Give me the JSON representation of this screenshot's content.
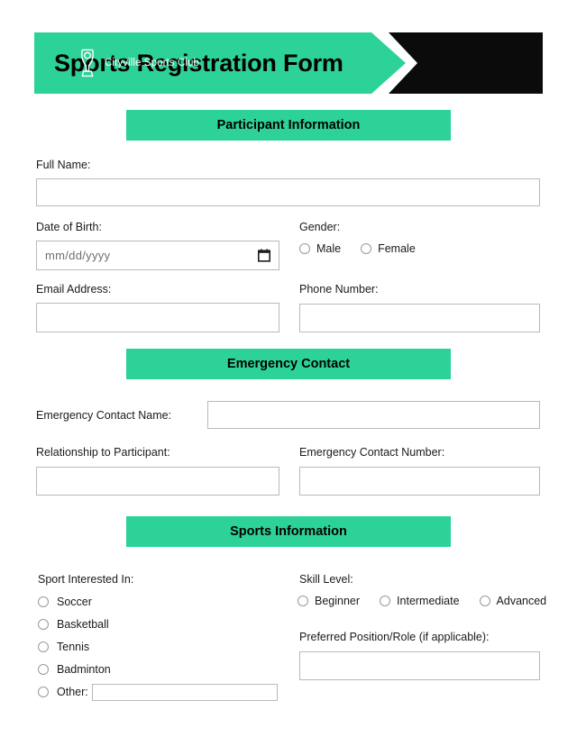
{
  "theme": {
    "accent_green": "#2dd298",
    "banner_black": "#0b0b0b",
    "text": "#1a1a1a",
    "input_border": "#b9b9b9"
  },
  "header": {
    "title": "Sports Registration Form",
    "brand_name": "Cityville Sports Club",
    "logo_icon": "trophy-icon"
  },
  "sections": {
    "participant": {
      "heading": "Participant Information"
    },
    "emergency": {
      "heading": "Emergency Contact"
    },
    "sports": {
      "heading": "Sports Information"
    }
  },
  "participant": {
    "full_name": {
      "label": "Full Name:",
      "value": "",
      "placeholder": ""
    },
    "date_of_birth": {
      "label": "Date of Birth:",
      "value": "",
      "placeholder": "mm/dd/yyyy",
      "icon": "calendar-icon"
    },
    "gender": {
      "label": "Gender:",
      "options": [
        "Male",
        "Female"
      ],
      "selected": ""
    },
    "email": {
      "label": "Email Address:",
      "value": "",
      "placeholder": ""
    },
    "phone": {
      "label": "Phone Number:",
      "value": "",
      "placeholder": ""
    }
  },
  "emergency": {
    "contact_name": {
      "label": "Emergency Contact Name:",
      "value": "",
      "placeholder": ""
    },
    "relationship": {
      "label": "Relationship to Participant:",
      "value": "",
      "placeholder": ""
    },
    "contact_number": {
      "label": "Emergency Contact Number:",
      "value": "",
      "placeholder": ""
    }
  },
  "sports": {
    "sport_interested": {
      "label": "Sport Interested In:",
      "options": [
        "Soccer",
        "Basketball",
        "Tennis",
        "Badminton",
        "Other:"
      ],
      "selected": "",
      "other_value": "",
      "other_placeholder": ""
    },
    "skill_level": {
      "label": "Skill Level:",
      "options": [
        "Beginner",
        "Intermediate",
        "Advanced"
      ],
      "selected": ""
    },
    "preferred_position": {
      "label": "Preferred Position/Role (if applicable):",
      "value": "",
      "placeholder": ""
    }
  }
}
